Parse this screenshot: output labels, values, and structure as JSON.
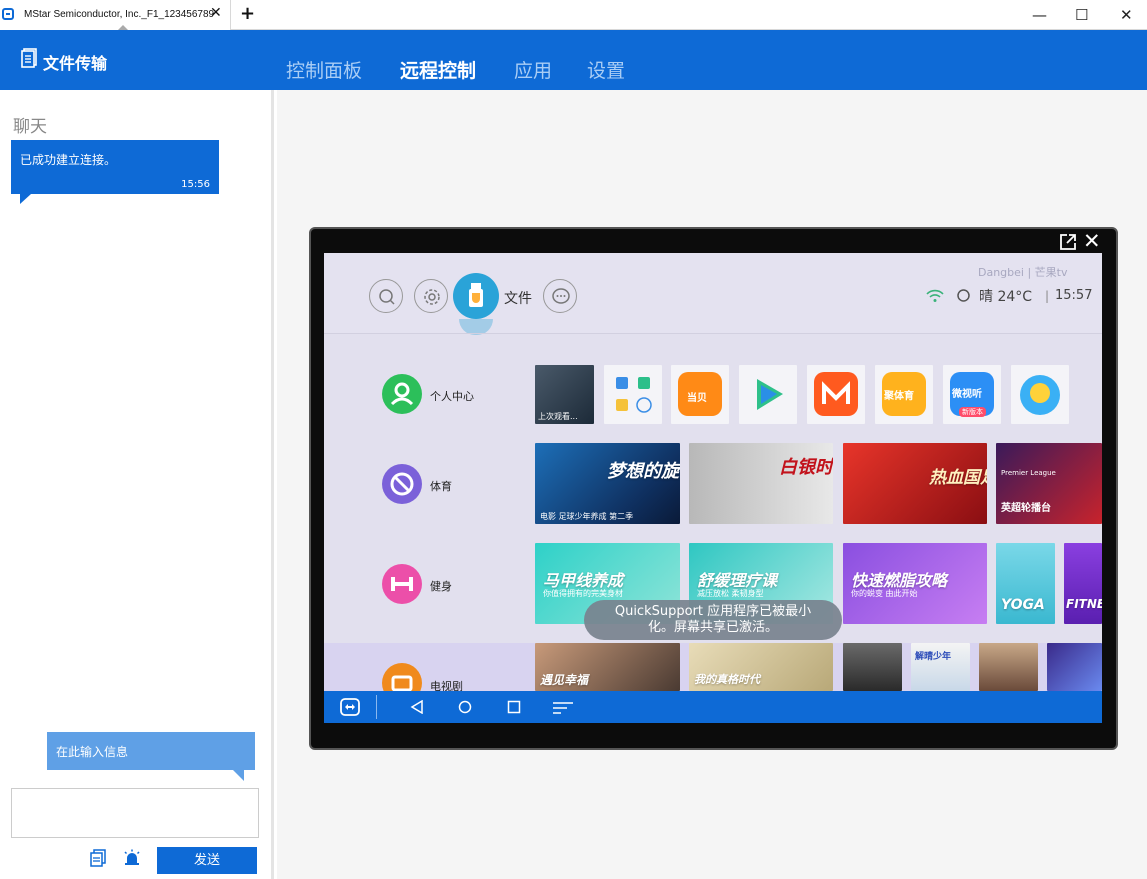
{
  "window": {
    "tab_title": "MStar Semiconductor, Inc._F1_123456789",
    "tab_close": "✕",
    "new_tab": "+",
    "minimize": "—",
    "maximize": "☐",
    "close": "✕"
  },
  "header": {
    "file_transfer": "文件传输",
    "nav": [
      "控制面板",
      "远程控制",
      "应用",
      "设置"
    ],
    "active_nav": "远程控制"
  },
  "chat": {
    "heading": "聊天",
    "messages": [
      {
        "text": "已成功建立连接。",
        "time": "15:56"
      }
    ],
    "input_hint": "在此输入信息",
    "input_value": "",
    "send_label": "发送"
  },
  "tv": {
    "brand": "Dangbei | 芒果tv",
    "top_icons": [
      "search-icon",
      "settings-icon",
      "usb-files-icon",
      "message-icon"
    ],
    "files_label": "文件",
    "weather": "晴 24°C",
    "clock": "15:57",
    "categories": [
      {
        "label": "个人中心",
        "color": "#2cbf5a"
      },
      {
        "label": "体育",
        "color": "#7b61d9"
      },
      {
        "label": "健身",
        "color": "#ec4fa9"
      },
      {
        "label": "电视剧",
        "color": "#f08a1c"
      }
    ],
    "apps": {
      "recent_label": "上次观看...",
      "dangbei_label": "当贝",
      "sports_app_label": "聚体育",
      "weishi_label": "微视听",
      "weishi_badge": "新版本"
    },
    "sports_tiles": [
      {
        "title": "梦想的旋",
        "caption": "电影   足球少年养成 第二季"
      },
      {
        "title": "白银时代",
        "caption": ""
      },
      {
        "title": "热血国足",
        "caption": ""
      },
      {
        "title": "英超轮播台",
        "caption": "Premier League"
      }
    ],
    "fitness_tiles": [
      {
        "title": "马甲线养成",
        "caption": "你值得拥有的完美身材"
      },
      {
        "title": "舒缓理疗课",
        "caption": "减压放松 柔韧身型"
      },
      {
        "title": "快速燃脂攻略",
        "caption": "你的蜕变 由此开始"
      },
      {
        "title": "YOGA",
        "caption": ""
      },
      {
        "title": "FITNE",
        "caption": ""
      }
    ],
    "tv_tiles": [
      {
        "title": "遇见幸福"
      },
      {
        "title": "我的真格时代"
      },
      {
        "title": ""
      },
      {
        "title": "解晴少年"
      },
      {
        "title": ""
      },
      {
        "title": ""
      }
    ],
    "toast": "QuickSupport 应用程序已被最小化。屏幕共享已激活。",
    "toast_line1": "QuickSupport 应用程序已被最小",
    "toast_line2": "化。屏幕共享已激活。"
  }
}
